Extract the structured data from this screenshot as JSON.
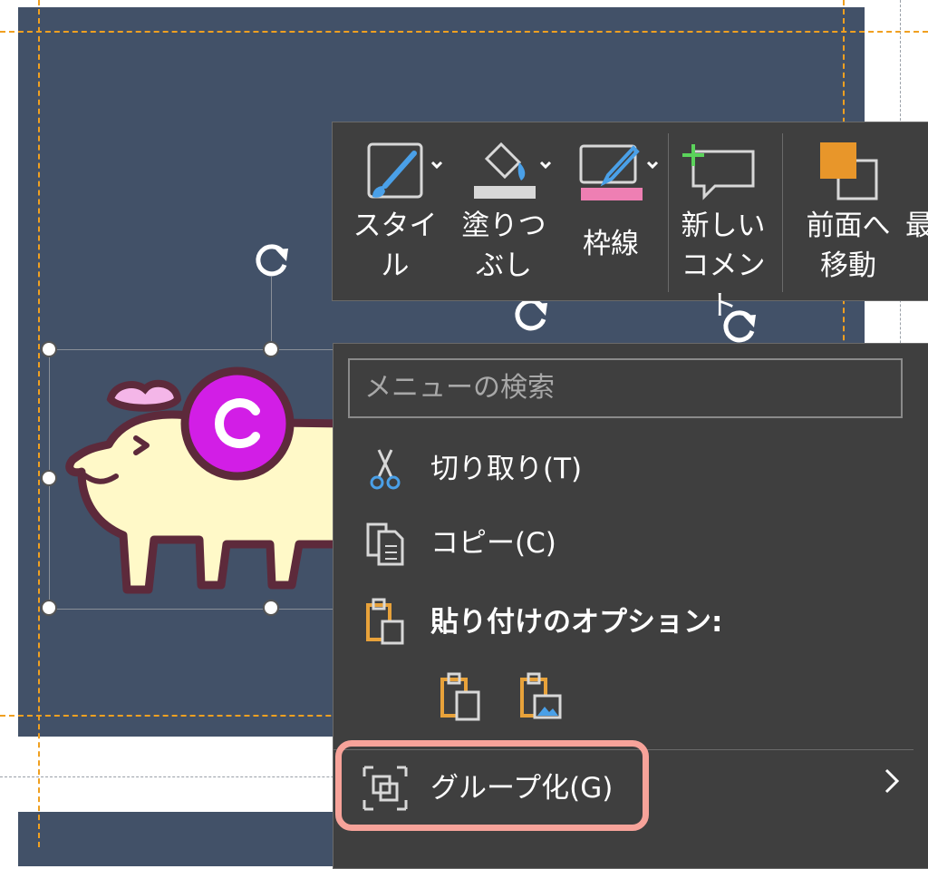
{
  "mini_toolbar": {
    "style_label": "スタイ\nル",
    "fill_label": "塗りつ\nぶし",
    "outline_label": "枠線",
    "new_comment_label": "新しい\nコメント",
    "bring_forward_label": "前面へ\n移動",
    "truncated_label": "最"
  },
  "context_menu": {
    "search_placeholder": "メニューの検索",
    "cut_label": "切り取り(T)",
    "copy_label": "コピー(C)",
    "paste_options_label": "貼り付けのオプション:",
    "group_label": "グループ化(G)"
  },
  "icons": {
    "style": "brush-shape-icon",
    "fill": "paint-bucket-icon",
    "outline": "pen-outline-icon",
    "comment": "new-comment-icon",
    "bring_forward": "bring-forward-icon",
    "cut": "scissors-icon",
    "copy": "copy-icon",
    "paste": "clipboard-icon",
    "paste_keep": "paste-keep-source-icon",
    "paste_picture": "paste-picture-icon",
    "group": "group-icon",
    "submenu": "chevron-right-icon",
    "rotate": "rotate-handle-icon"
  },
  "colors": {
    "slide_bg": "#425168",
    "menu_bg": "#3f3f3f",
    "highlight": "#f7a39a",
    "guide": "#f0a020",
    "fill_accent": "#d8d8d8",
    "outline_accent": "#ee7fb3",
    "comment_plus": "#5bd35b",
    "forward_orange": "#e8962a"
  }
}
